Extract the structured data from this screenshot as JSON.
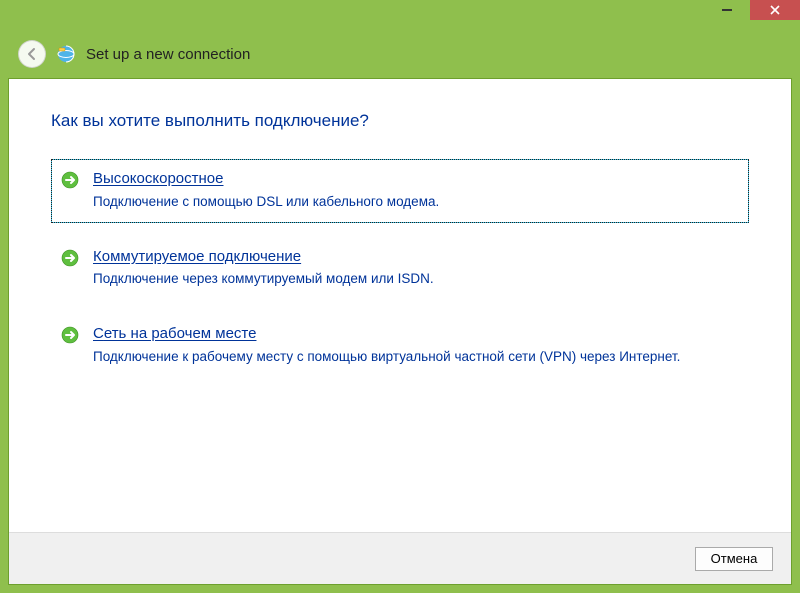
{
  "window": {
    "title": "Set up a new connection"
  },
  "page": {
    "heading": "Как вы хотите выполнить подключение?"
  },
  "options": [
    {
      "accesskey": "В",
      "title_rest": "ысокоскоростное",
      "desc": "Подключение с помощью DSL или кабельного модема.",
      "selected": true
    },
    {
      "accesskey": "К",
      "title_rest": "оммутируемое подключение",
      "desc": "Подключение через коммутируемый модем или ISDN.",
      "selected": false
    },
    {
      "accesskey": "С",
      "title_rest": "еть на рабочем месте",
      "desc": "Подключение к рабочему месту с помощью виртуальной частной сети (VPN) через Интернет.",
      "selected": false
    }
  ],
  "footer": {
    "cancel": "Отмена"
  }
}
